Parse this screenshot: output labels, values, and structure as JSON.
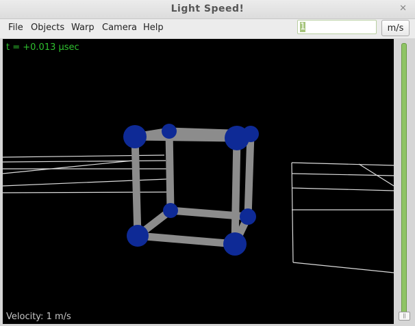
{
  "window": {
    "title": "Light Speed!",
    "close_icon": "close-icon"
  },
  "menu": [
    "File",
    "Objects",
    "Warp",
    "Camera",
    "Help"
  ],
  "velocity_input": {
    "value": "1",
    "unit_button": "m/s"
  },
  "viewport": {
    "time_readout": "t = +0.013 µsec",
    "velocity_readout": "Velocity: 1 m/s"
  },
  "slider": {
    "position_fraction": 0.0,
    "accent": "#8fc465"
  }
}
